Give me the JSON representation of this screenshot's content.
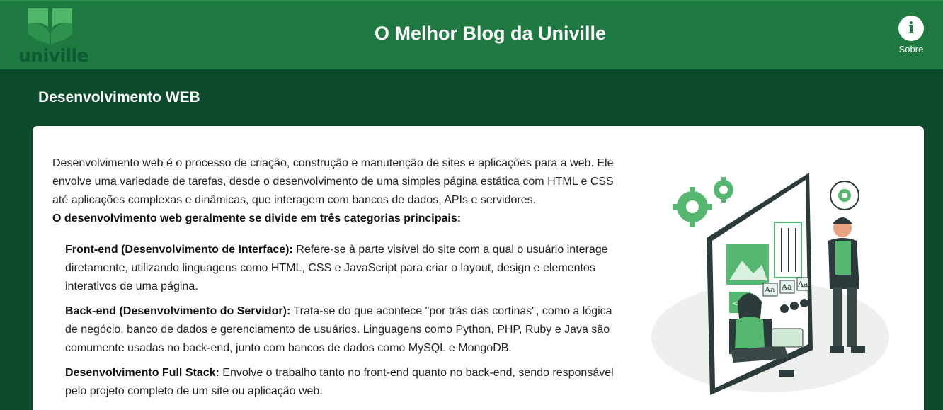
{
  "header": {
    "logo_text": "univille",
    "title": "O Melhor Blog da Univille",
    "about_label": "Sobre",
    "about_icon": "info-icon"
  },
  "section": {
    "title": "Desenvolvimento WEB"
  },
  "article": {
    "intro_1": "Desenvolvimento web é o processo de criação, construção e manutenção de sites e aplicações para a web.",
    "intro_2": "Ele envolve uma variedade de tarefas, desde o desenvolvimento de uma simples página estática com HTML e CSS até aplicações complexas e dinâmicas, que interagem com bancos de dados, APIs e servidores.",
    "lead": "O desenvolvimento web geralmente se divide em três categorias principais:",
    "items": [
      {
        "title": "Front-end (Desenvolvimento de Interface):",
        "text": " Refere-se à parte visível do site com a qual o usuário interage diretamente, utilizando linguagens como HTML, CSS e JavaScript para criar o layout, design e elementos interativos de uma página."
      },
      {
        "title": "Back-end (Desenvolvimento do Servidor):",
        "text": " Trata-se do que acontece \"por trás das cortinas\", como a lógica de negócio, banco de dados e gerenciamento de usuários. Linguagens como Python, PHP, Ruby e Java são comumente usadas no back-end, junto com bancos de dados como MySQL e MongoDB."
      },
      {
        "title": "Desenvolvimento Full Stack:",
        "text": " Envolve o trabalho tanto no front-end quanto no back-end, sendo responsável pelo projeto completo de um site ou aplicação web."
      }
    ]
  },
  "illustration": {
    "font_labels": [
      "Aa",
      "Aa",
      "Aa"
    ],
    "code_label": "</>"
  },
  "colors": {
    "header_bg": "#1f7a41",
    "page_bg": "#0b4a2a",
    "accent_green": "#3aaa5c",
    "card_bg": "#ffffff"
  }
}
